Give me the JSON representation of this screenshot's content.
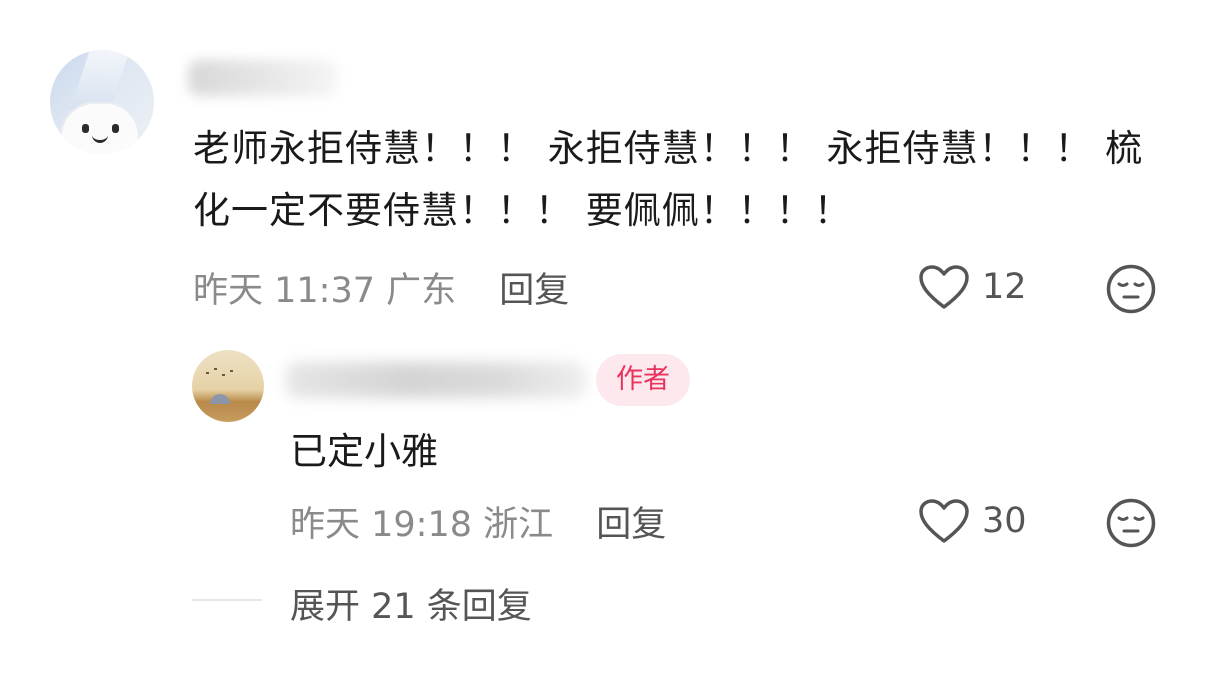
{
  "comment": {
    "text": "老师永拒侍慧！！！ 永拒侍慧！！！ 永拒侍慧！！！ 梳化一定不要侍慧！！！ 要佩佩！！！！",
    "time": "昨天 11:37",
    "location": "广东",
    "reply_label": "回复",
    "likes": "12"
  },
  "reply": {
    "badge": "作者",
    "text": "已定小雅",
    "time": "昨天 19:18",
    "location": "浙江",
    "reply_label": "回复",
    "likes": "30"
  },
  "expand": {
    "label": "展开 21 条回复"
  },
  "colors": {
    "accent": "#e8335d",
    "badge_bg": "#fde8ee",
    "meta_gray": "#8a8a8a",
    "icon_gray": "#555555"
  },
  "icons": [
    "heart-icon",
    "dislike-face-icon"
  ]
}
